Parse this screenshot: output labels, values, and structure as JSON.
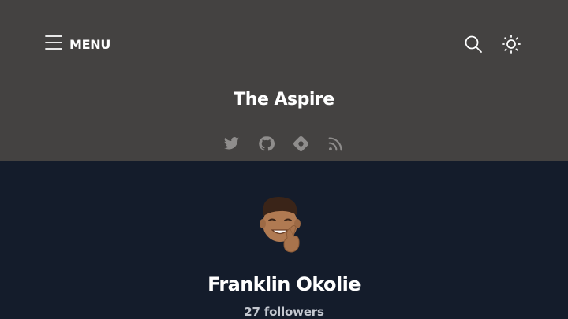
{
  "header": {
    "menu_label": "MENU",
    "site_title": "The Aspire",
    "background": "#444241",
    "icons": {
      "menu": "hamburger-icon",
      "search": "search-icon",
      "theme": "sun-icon"
    },
    "socials": [
      {
        "icon": "twitter-icon"
      },
      {
        "icon": "github-icon"
      },
      {
        "icon": "hashnode-icon"
      },
      {
        "icon": "rss-icon"
      }
    ]
  },
  "profile": {
    "name": "Franklin Okolie",
    "followers": "27 followers",
    "background": "#141c2b",
    "avatar_icon": "memoji-avatar"
  }
}
